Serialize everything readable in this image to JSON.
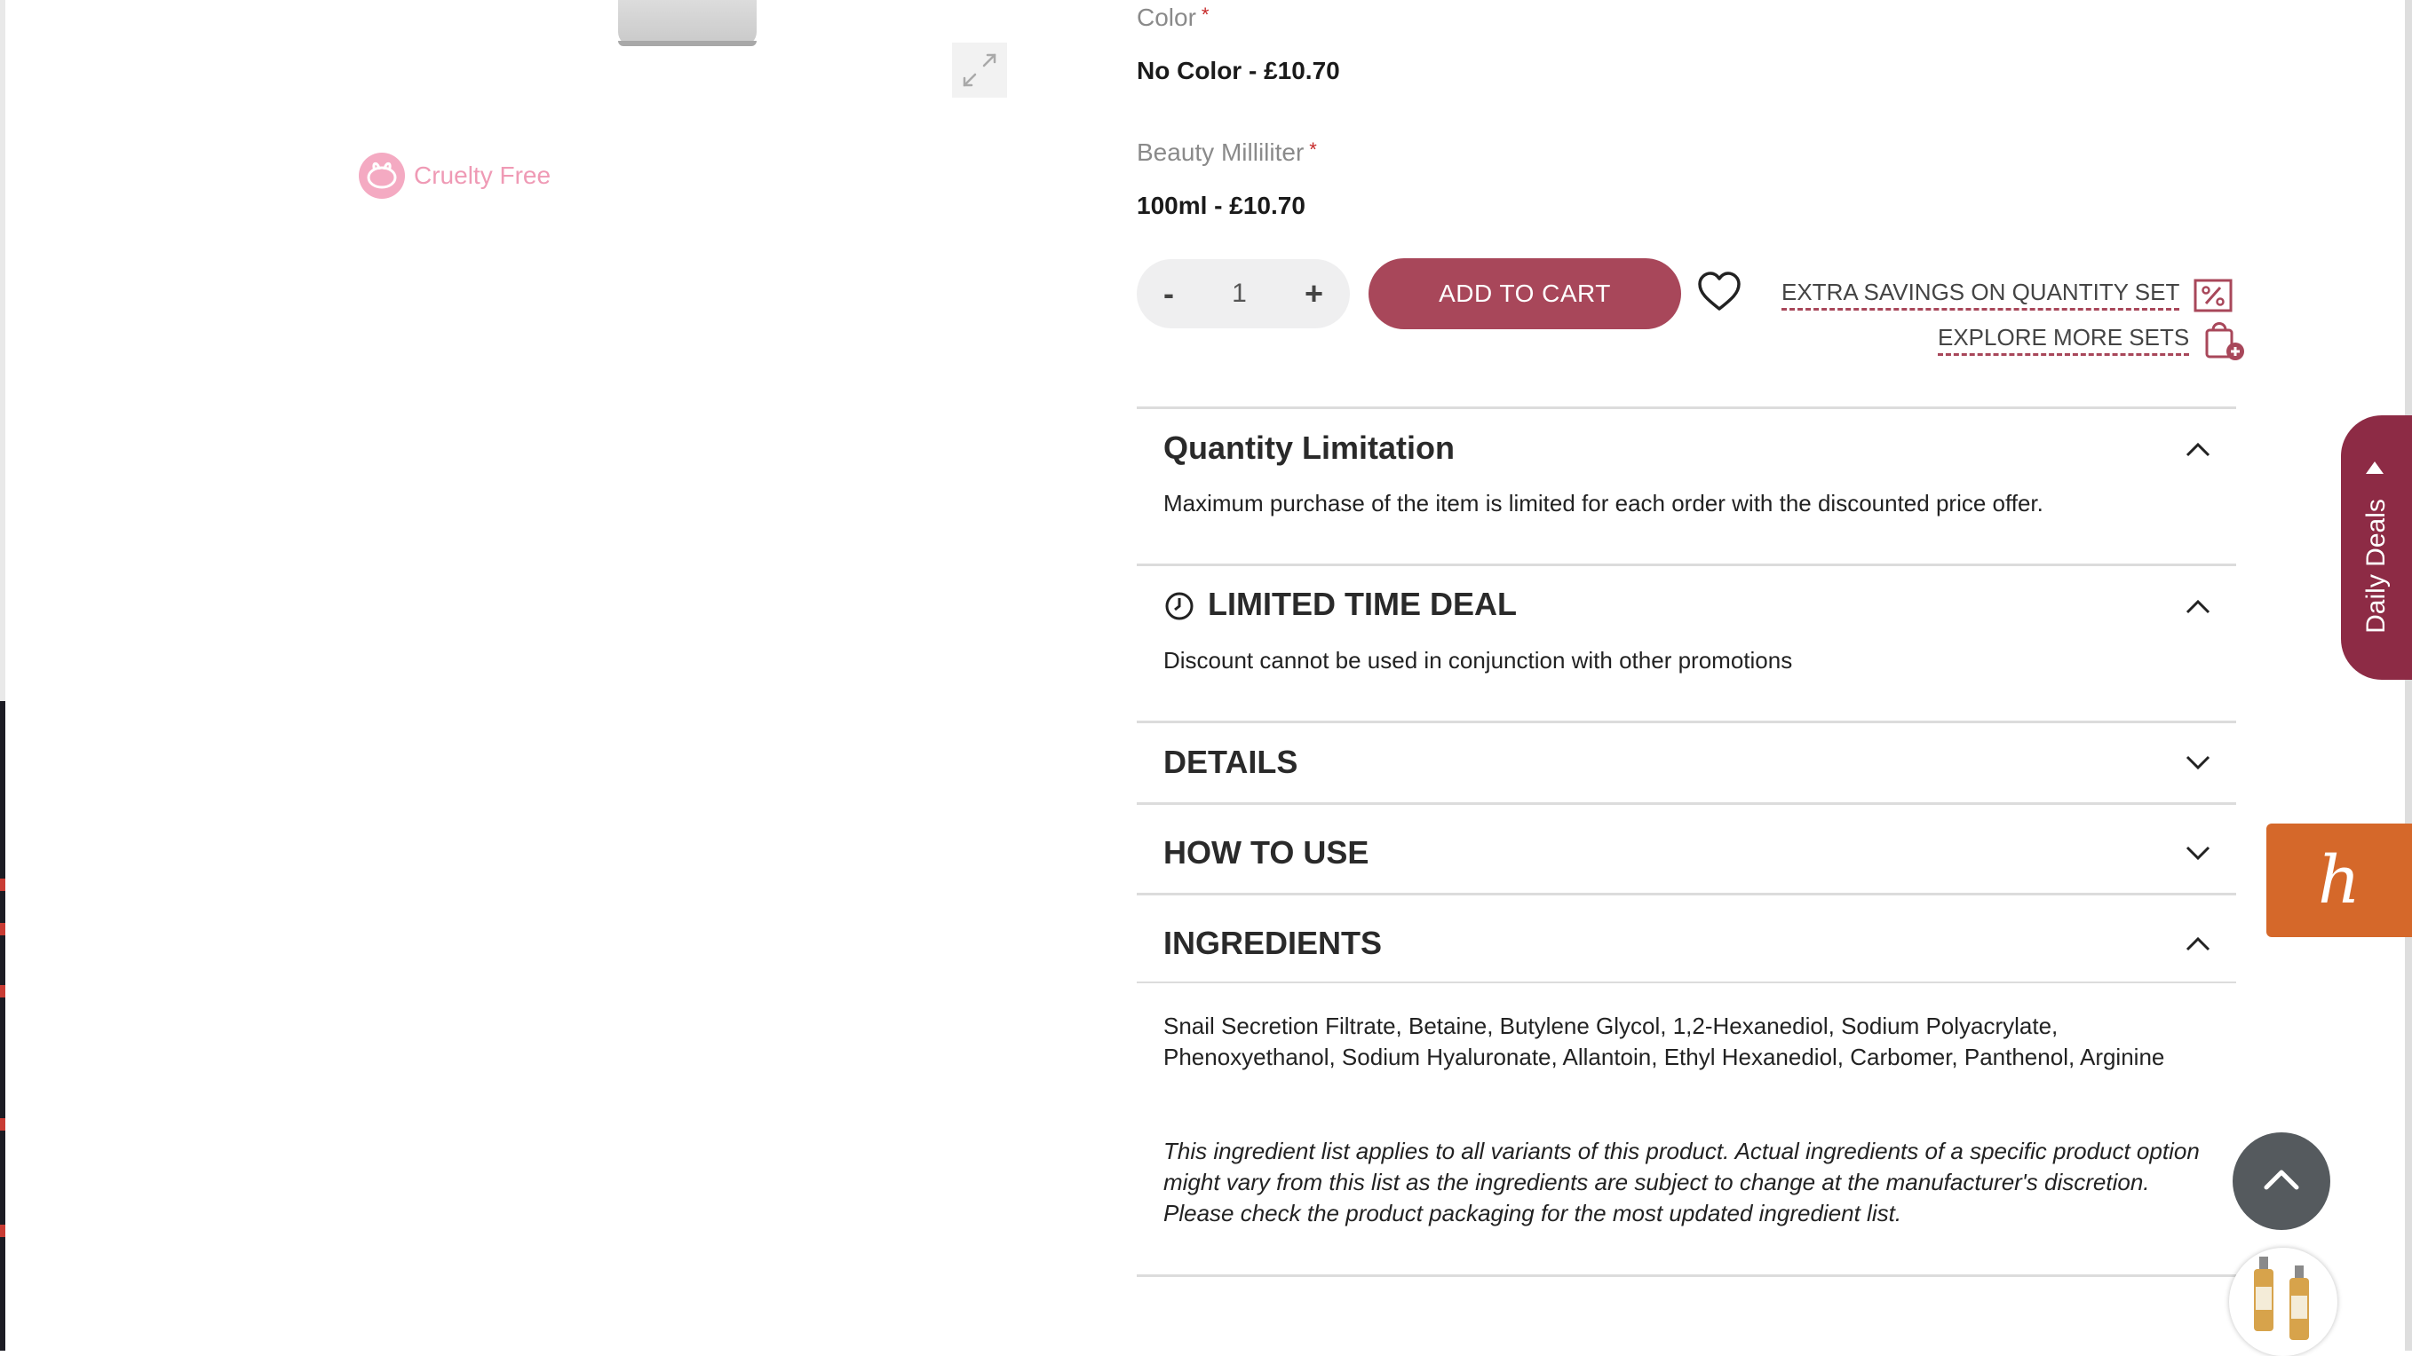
{
  "product_image": {
    "expand_icon": "expand-arrows-icon"
  },
  "badges": {
    "cruelty_free": "Cruelty Free"
  },
  "options": {
    "color": {
      "label": "Color",
      "required_mark": "*",
      "value": "No Color - £10.70"
    },
    "volume": {
      "label": "Beauty Milliliter",
      "required_mark": "*",
      "value": "100ml - £10.70"
    }
  },
  "purchase": {
    "qty_minus": "-",
    "qty_value": "1",
    "qty_plus": "+",
    "add_to_cart": "ADD TO CART",
    "wishlist_icon": "heart-icon"
  },
  "links": {
    "extra_savings": "EXTRA SAVINGS ON QUANTITY SET",
    "explore_sets": "EXPLORE MORE SETS"
  },
  "sections": {
    "quantity_limitation": {
      "title": "Quantity Limitation",
      "body": "Maximum purchase of the item is limited for each order with the discounted price offer.",
      "expanded": true
    },
    "limited_time_deal": {
      "title": "LIMITED TIME DEAL",
      "body": "Discount cannot be used in conjunction with other promotions",
      "expanded": true
    },
    "details": {
      "title": "DETAILS",
      "expanded": false
    },
    "how_to_use": {
      "title": "HOW TO USE",
      "expanded": false
    },
    "ingredients": {
      "title": "INGREDIENTS",
      "expanded": true,
      "list": "Snail Secretion Filtrate, Betaine, Butylene Glycol, 1,2-Hexanediol, Sodium Polyacrylate, Phenoxyethanol, Sodium Hyaluronate, Allantoin, Ethyl Hexanediol, Carbomer, Panthenol, Arginine",
      "disclaimer": "This ingredient list applies to all variants of this product. Actual ingredients of a specific product option might vary from this list as the ingredients are subject to change at the manufacturer's discretion. Please check the product packaging for the most updated ingredient list."
    }
  },
  "floating": {
    "daily_deals": "Daily Deals",
    "honey_logo": "h",
    "scroll_top_icon": "chevron-up-icon"
  },
  "colors": {
    "accent": "#a8475a",
    "deals_tab": "#8d2b45",
    "honey": "#d5682a",
    "required": "#c62828"
  }
}
